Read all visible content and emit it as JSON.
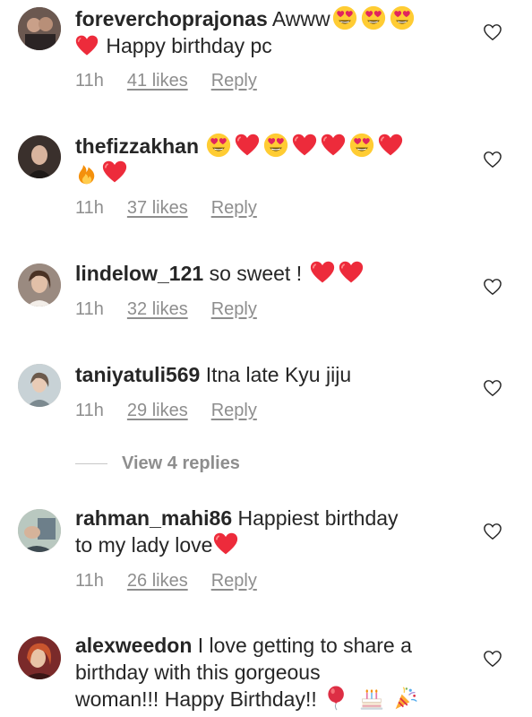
{
  "comments": [
    {
      "username": "foreverchoprajonas",
      "text_before": "Awww",
      "line2": "Happy birthday pc",
      "time": "11h",
      "likes": "41 likes",
      "reply": "Reply"
    },
    {
      "username": "thefizzakhan",
      "time": "11h",
      "likes": "37 likes",
      "reply": "Reply"
    },
    {
      "username": "lindelow_121",
      "text": "so sweet !",
      "time": "11h",
      "likes": "32 likes",
      "reply": "Reply"
    },
    {
      "username": "taniyatuli569",
      "text": "Itna late Kyu jiju",
      "time": "11h",
      "likes": "29 likes",
      "reply": "Reply",
      "view_replies": "View 4 replies"
    },
    {
      "username": "rahman_mahi86",
      "text": "Happiest birthday",
      "line2": "to my lady love",
      "time": "11h",
      "likes": "26 likes",
      "reply": "Reply"
    },
    {
      "username": "alexweedon",
      "text": "I love getting to share a",
      "line2": "birthday with this gorgeous",
      "line3": "woman!!! Happy Birthday!!"
    }
  ],
  "icons": {
    "like": "heart-outline-icon",
    "heart_emoji": "red-heart-emoji",
    "heart_eyes": "heart-eyes-emoji",
    "fire": "fire-emoji",
    "balloon": "balloon-emoji",
    "cake": "birthday-cake-emoji",
    "party": "party-popper-emoji"
  },
  "colors": {
    "text": "#262626",
    "secondary": "#8e8e8e",
    "heart": "#ed2b3b",
    "emoji_face": "#ffcc33"
  }
}
